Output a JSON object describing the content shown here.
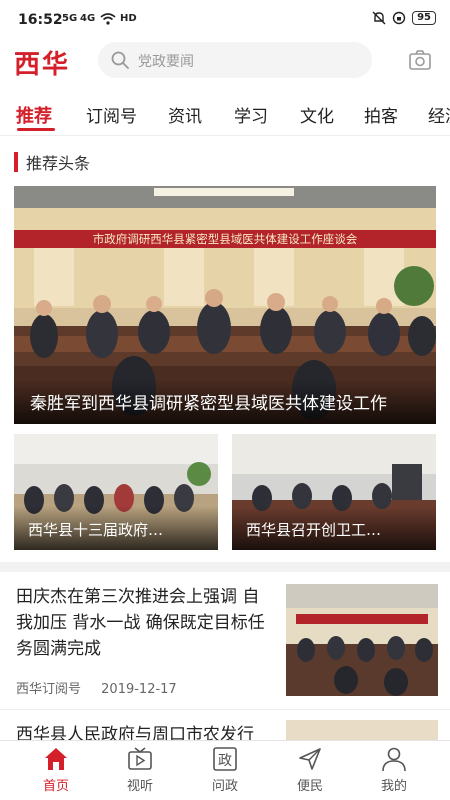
{
  "status_bar": {
    "time": "16:52",
    "signal_1": "5G",
    "signal_2": "4G",
    "network": "HD",
    "battery": "95"
  },
  "header": {
    "logo": "西华",
    "search_placeholder": "党政要闻",
    "icons": [
      "search-icon",
      "camera-icon"
    ]
  },
  "tabs": [
    "推荐",
    "订阅号",
    "资讯",
    "学习",
    "文化",
    "拍客",
    "经济"
  ],
  "active_tab": "推荐",
  "section": {
    "title": "推荐头条"
  },
  "hero": {
    "banner_text": "市政府调研西华县紧密型县域医共体建设工作座谈会",
    "caption": "秦胜军到西华县调研紧密型县域医共体建设工作"
  },
  "thumbs": [
    {
      "caption": "西华县十三届政府…"
    },
    {
      "caption": "西华县召开创卫工…"
    }
  ],
  "news": [
    {
      "title": "田庆杰在第三次推进会上强调 自我加压 背水一战 确保既定目标任务圆满完成",
      "source": "西华订阅号",
      "date": "2019-12-17"
    },
    {
      "title": "西华县人民政府与周口市农发行"
    }
  ],
  "bottom_nav": [
    {
      "label": "首页",
      "icon": "home-icon"
    },
    {
      "label": "视听",
      "icon": "tv-icon"
    },
    {
      "label": "问政",
      "icon": "government-icon"
    },
    {
      "label": "便民",
      "icon": "send-icon"
    },
    {
      "label": "我的",
      "icon": "user-icon"
    }
  ],
  "colors": {
    "accent": "#d4202a"
  }
}
